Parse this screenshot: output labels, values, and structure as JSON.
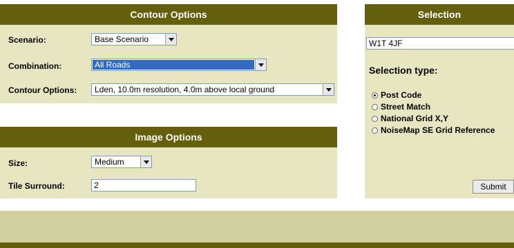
{
  "contour": {
    "title": "Contour Options",
    "scenario_label": "Scenario:",
    "scenario_value": "Base Scenario",
    "combination_label": "Combination:",
    "combination_value": "All Roads",
    "options_label": "Contour Options:",
    "options_value": "Lden, 10.0m resolution, 4.0m above local ground"
  },
  "image": {
    "title": "Image Options",
    "size_label": "Size:",
    "size_value": "Medium",
    "tile_label": "Tile Surround:",
    "tile_value": "2"
  },
  "selection": {
    "title": "Selection",
    "search_value": "W1T 4JF",
    "type_label": "Selection type:",
    "options": [
      "Post Code",
      "Street Match",
      "National Grid X,Y",
      "NoiseMap SE Grid Reference"
    ],
    "selected_index": 0,
    "submit_label": "Submit"
  },
  "colors": {
    "header": "#645f0c",
    "panel": "#e6e6c0",
    "band": "#d0cf9e"
  }
}
